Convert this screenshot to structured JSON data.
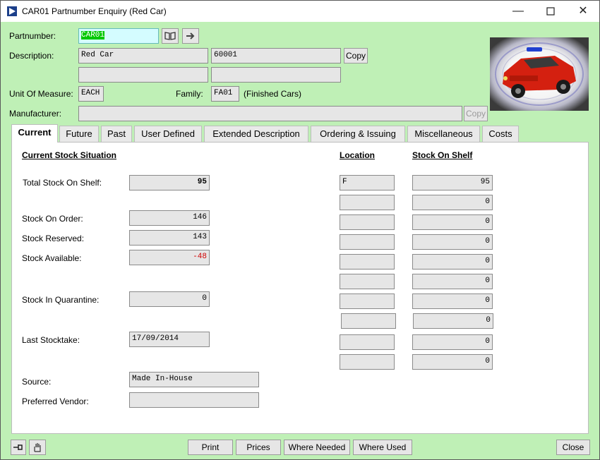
{
  "window": {
    "title": "CAR01 Partnumber Enquiry (Red Car)"
  },
  "header": {
    "partnumber_label": "Partnumber:",
    "partnumber_value": "CAR01",
    "description_label": "Description:",
    "description1": "Red Car",
    "description_code": "60001",
    "description2": "",
    "description3": "",
    "copy_label": "Copy",
    "uom_label": "Unit Of Measure:",
    "uom_value": "EACH",
    "family_label": "Family:",
    "family_value": "FA01",
    "family_desc": "(Finished Cars)",
    "manufacturer_label": "Manufacturer:",
    "manufacturer_value": "",
    "manufacturer_copy_label": "Copy"
  },
  "tabs": [
    "Current",
    "Future",
    "Past",
    "User Defined",
    "Extended Description",
    "Ordering & Issuing",
    "Miscellaneous",
    "Costs"
  ],
  "current": {
    "section_title": "Current Stock Situation",
    "total_stock_label": "Total Stock On Shelf:",
    "total_stock_value": "95",
    "stock_on_order_label": "Stock On Order:",
    "stock_on_order_value": "146",
    "stock_reserved_label": "Stock Reserved:",
    "stock_reserved_value": "143",
    "stock_available_label": "Stock Available:",
    "stock_available_value": "-48",
    "quarantine_label": "Stock In Quarantine:",
    "quarantine_value": "0",
    "last_stocktake_label": "Last Stocktake:",
    "last_stocktake_value": "17/09/2014",
    "source_label": "Source:",
    "source_value": "Made In-House",
    "preferred_vendor_label": "Preferred Vendor:",
    "preferred_vendor_value": "",
    "location_header": "Location",
    "stock_on_shelf_header": "Stock On Shelf",
    "locations": [
      "F",
      "",
      "",
      "",
      "",
      "",
      "",
      "",
      "",
      ""
    ],
    "shelf_values": [
      "95",
      "0",
      "0",
      "0",
      "0",
      "0",
      "0",
      "0",
      "0",
      "0"
    ]
  },
  "footer": {
    "print": "Print",
    "prices": "Prices",
    "where_needed": "Where Needed",
    "where_used": "Where Used",
    "close": "Close"
  },
  "colors": {
    "background": "#bff0b6",
    "negative": "#d00000",
    "partnumber_highlight": "#00c800"
  }
}
